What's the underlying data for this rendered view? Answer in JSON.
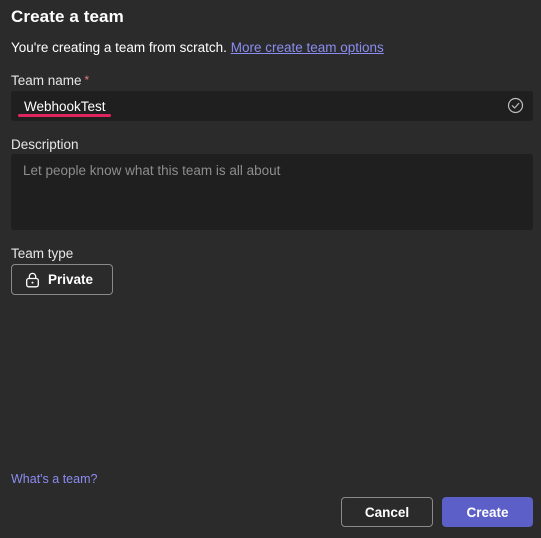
{
  "dialog": {
    "title": "Create a team",
    "subtitle_text": "You're creating a team from scratch.",
    "subtitle_link": "More create team options"
  },
  "team_name": {
    "label": "Team name",
    "required_marker": "*",
    "value": "WebhookTest",
    "status_icon": "check-circle-icon"
  },
  "description": {
    "label": "Description",
    "placeholder": "Let people know what this team is all about",
    "value": ""
  },
  "team_type": {
    "label": "Team type",
    "selected": "Private",
    "icon": "lock-icon"
  },
  "footer": {
    "help_link": "What's a team?",
    "cancel_label": "Cancel",
    "create_label": "Create"
  },
  "colors": {
    "background": "#2b2b2b",
    "field_background": "#1f1f1f",
    "link": "#8b8cf0",
    "accent": "#5b5fc7",
    "spellcheck_underline": "#e0245e"
  }
}
